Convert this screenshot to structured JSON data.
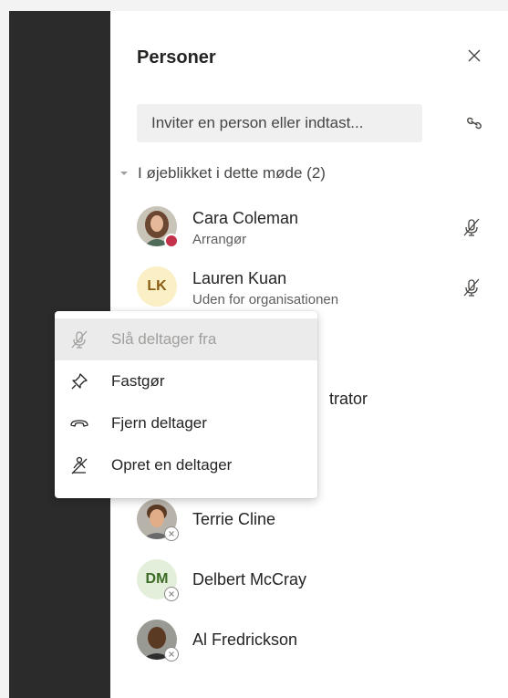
{
  "panel": {
    "title": "Personer",
    "invite_placeholder": "Inviter en person eller indtast...",
    "section_label": "I øjeblikket i dette møde (2)"
  },
  "participants": [
    {
      "name": "Cara Coleman",
      "role": "Arrangør",
      "status": "busy"
    },
    {
      "name": "Lauren Kuan",
      "role": "Uden for organisationen",
      "initials": "LK"
    }
  ],
  "hidden_partial_text": "trator",
  "others": [
    {
      "name": "Terrie Cline",
      "status": "offline"
    },
    {
      "name": "Delbert McCray",
      "initials": "DM",
      "status": "offline"
    },
    {
      "name": "Al Fredrickson",
      "status": "offline"
    }
  ],
  "context_menu": {
    "items": [
      {
        "label": "Slå deltager fra",
        "icon": "mic-off-icon",
        "disabled": true
      },
      {
        "label": "Fastgør",
        "icon": "pin-icon"
      },
      {
        "label": "Fjern deltager",
        "icon": "hang-up-icon"
      },
      {
        "label": "Opret en deltager",
        "icon": "attendee-icon"
      }
    ]
  },
  "colors": {
    "rail": "#2b2b2b",
    "busy": "#c4314b",
    "lk_avatar_bg": "#fbefc6",
    "lk_avatar_fg": "#8a5d12",
    "dm_avatar_bg": "#e3efdb",
    "dm_avatar_fg": "#3c6b25"
  }
}
